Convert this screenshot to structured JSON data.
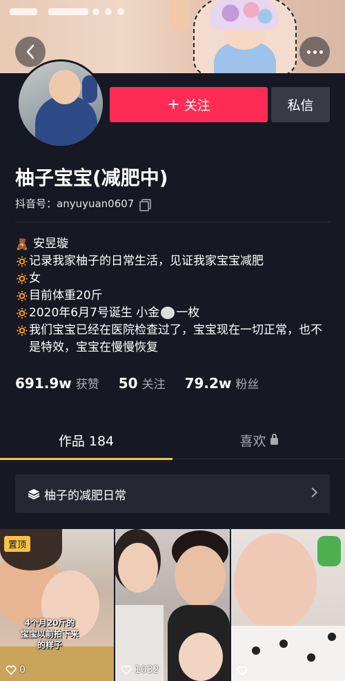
{
  "profile": {
    "nickname": "柚子宝宝(减肥中)",
    "douyin_id": "抖音号：anyuyuan0607",
    "follow_label": "关注",
    "message_label": "私信"
  },
  "bio": {
    "emoji_bear": "🧸",
    "emoji_sun": "🔅",
    "lines": [
      "安昱璇",
      "记录我家柚子的日常生活，见证我家宝宝减肥",
      "女",
      "目前体重20斤",
      "2020年6月7号诞生 小金",
      "一枚",
      "我们宝宝已经在医院检查过了，宝宝现在一切正常，也不是特效，宝宝在慢慢恢复"
    ]
  },
  "stats": {
    "likes_value": "691.9w",
    "likes_label": "获赞",
    "following_value": "50",
    "following_label": "关注",
    "followers_value": "79.2w",
    "followers_label": "粉丝"
  },
  "tabs": {
    "works_label": "作品 184",
    "likes_label": "喜欢"
  },
  "collection": {
    "label": "柚子的减肥日常"
  },
  "videos": [
    {
      "pinned": "置顶",
      "overlay": "4个月20斤的宝宝以前拍下来的样子",
      "likes": "0"
    },
    {
      "likes": "1032"
    },
    {
      "likes": ""
    }
  ]
}
